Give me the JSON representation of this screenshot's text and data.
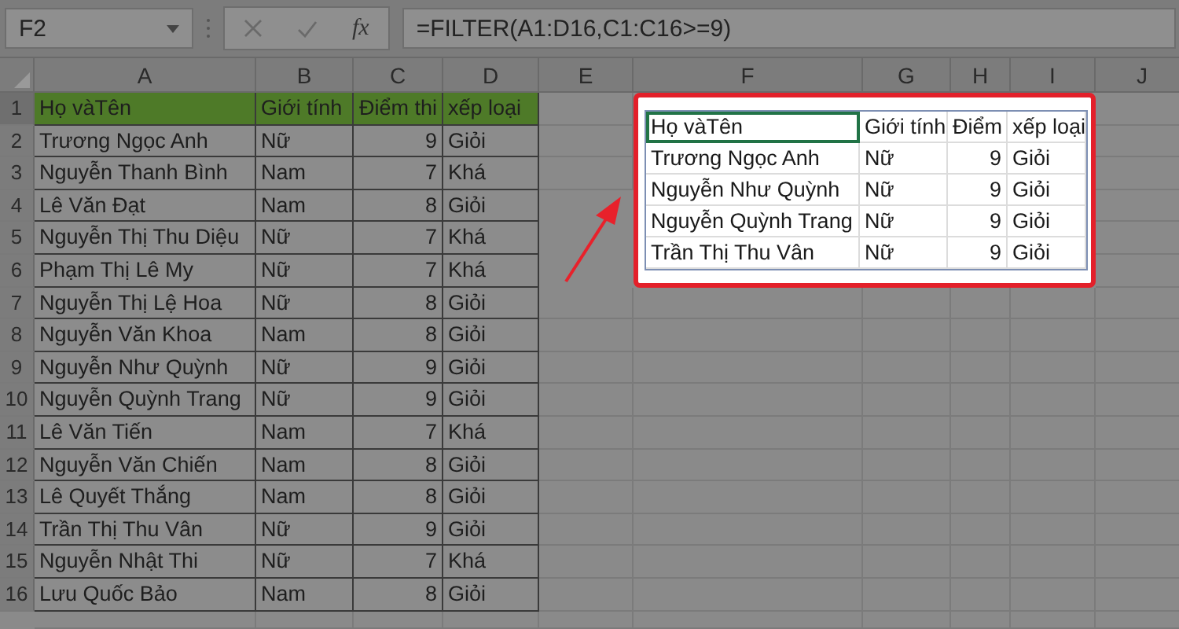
{
  "formula_bar": {
    "name_box": "F2",
    "function_label": "fx",
    "formula": "=FILTER(A1:D16,C1:C16>=9)"
  },
  "column_headers": [
    "A",
    "B",
    "C",
    "D",
    "E",
    "F",
    "G",
    "H",
    "I",
    "J"
  ],
  "row_numbers": [
    "1",
    "2",
    "3",
    "4",
    "5",
    "6",
    "7",
    "8",
    "9",
    "10",
    "11",
    "12",
    "13",
    "14",
    "15",
    "16"
  ],
  "source_table": {
    "columns": [
      {
        "label": "Họ vàTên",
        "kind": "text"
      },
      {
        "label": "Giới tính",
        "kind": "text"
      },
      {
        "label": "Điểm thi",
        "kind": "number"
      },
      {
        "label": "xếp loại",
        "kind": "text"
      }
    ],
    "rows": [
      [
        "Trương Ngọc Anh",
        "Nữ",
        "9",
        "Giỏi"
      ],
      [
        "Nguyễn Thanh Bình",
        "Nam",
        "7",
        "Khá"
      ],
      [
        "Lê Văn Đạt",
        "Nam",
        "8",
        "Giỏi"
      ],
      [
        "Nguyễn Thị Thu Diệu",
        "Nữ",
        "7",
        "Khá"
      ],
      [
        "Phạm Thị Lê My",
        "Nữ",
        "7",
        "Khá"
      ],
      [
        "Nguyễn Thị Lệ Hoa",
        "Nữ",
        "8",
        "Giỏi"
      ],
      [
        "Nguyễn Văn Khoa",
        "Nam",
        "8",
        "Giỏi"
      ],
      [
        "Nguyễn Như Quỳnh",
        "Nữ",
        "9",
        "Giỏi"
      ],
      [
        "Nguyễn Quỳnh Trang",
        "Nữ",
        "9",
        "Giỏi"
      ],
      [
        "Lê Văn Tiến",
        "Nam",
        "7",
        "Khá"
      ],
      [
        "Nguyễn Văn Chiến",
        "Nam",
        "8",
        "Giỏi"
      ],
      [
        "Lê Quyết Thắng",
        "Nam",
        "8",
        "Giỏi"
      ],
      [
        "Trần Thị Thu Vân",
        "Nữ",
        "9",
        "Giỏi"
      ],
      [
        "Nguyễn Nhật Thi",
        "Nữ",
        "7",
        "Khá"
      ],
      [
        "Lưu Quốc Bảo",
        "Nam",
        "8",
        "Giỏi"
      ]
    ]
  },
  "filter_result": {
    "anchor_selected": true,
    "columns": [
      {
        "label": "Họ vàTên",
        "kind": "text"
      },
      {
        "label": "Giới tính",
        "kind": "text"
      },
      {
        "label": "Điểm",
        "kind": "number"
      },
      {
        "label": "xếp loại",
        "kind": "text"
      }
    ],
    "rows": [
      [
        "Trương Ngọc Anh",
        "Nữ",
        "9",
        "Giỏi"
      ],
      [
        "Nguyễn Như Quỳnh",
        "Nữ",
        "9",
        "Giỏi"
      ],
      [
        "Nguyễn Quỳnh Trang",
        "Nữ",
        "9",
        "Giỏi"
      ],
      [
        "Trần Thị Thu Vân",
        "Nữ",
        "9",
        "Giỏi"
      ]
    ]
  }
}
